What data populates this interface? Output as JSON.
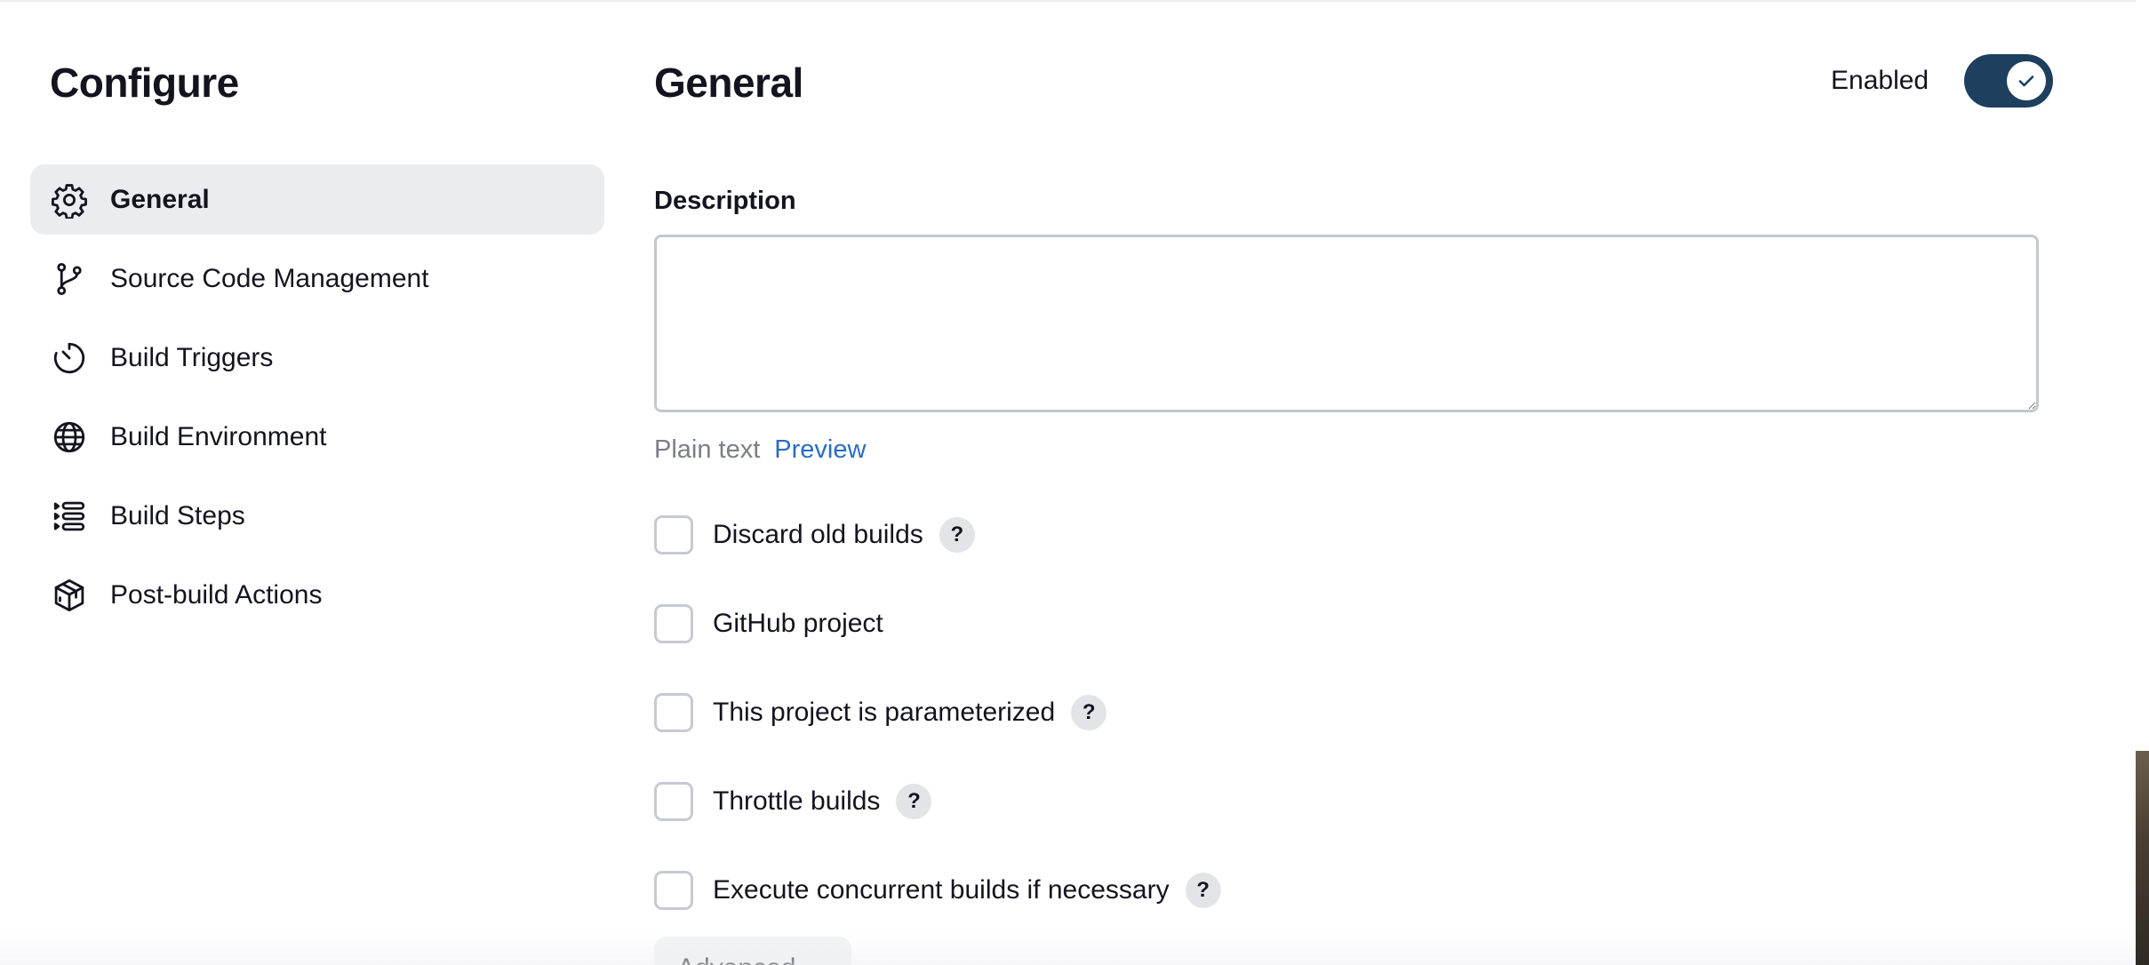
{
  "sidebar": {
    "title": "Configure",
    "items": [
      {
        "label": "General",
        "icon": "gear-icon",
        "active": true
      },
      {
        "label": "Source Code Management",
        "icon": "git-branch-icon",
        "active": false
      },
      {
        "label": "Build Triggers",
        "icon": "timer-icon",
        "active": false
      },
      {
        "label": "Build Environment",
        "icon": "globe-icon",
        "active": false
      },
      {
        "label": "Build Steps",
        "icon": "steps-list-icon",
        "active": false
      },
      {
        "label": "Post-build Actions",
        "icon": "package-icon",
        "active": false
      }
    ]
  },
  "main": {
    "title": "General",
    "enabled_label": "Enabled",
    "enabled": true,
    "description": {
      "label": "Description",
      "value": "",
      "format_plain": "Plain text",
      "format_preview": "Preview"
    },
    "options": [
      {
        "label": "Discard old builds",
        "checked": false,
        "help": "?"
      },
      {
        "label": "GitHub project",
        "checked": false,
        "help": null
      },
      {
        "label": "This project is parameterized",
        "checked": false,
        "help": "?"
      },
      {
        "label": "Throttle builds",
        "checked": false,
        "help": "?"
      },
      {
        "label": "Execute concurrent builds if necessary",
        "checked": false,
        "help": "?"
      }
    ],
    "advanced_label": "Advanced"
  },
  "colors": {
    "toggle_on": "#1e3f5e",
    "link": "#2b6cc4",
    "active_nav_bg": "#ebecf0"
  }
}
